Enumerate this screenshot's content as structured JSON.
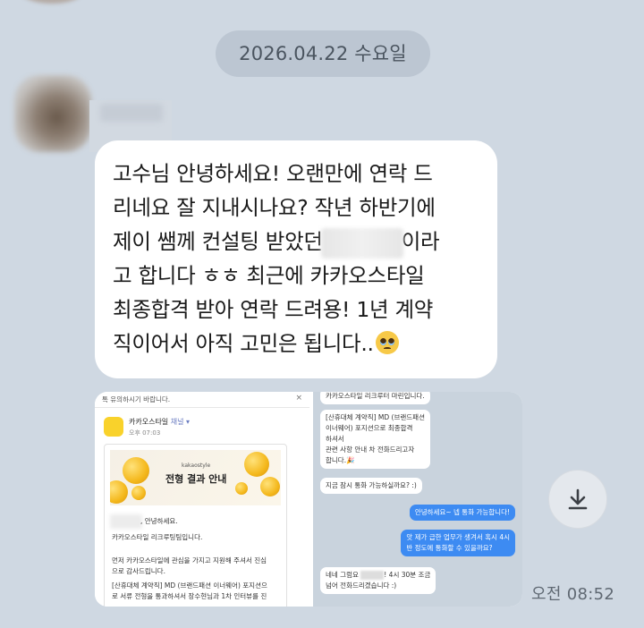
{
  "chat": {
    "date_divider": "2026.04.22 수요일",
    "message": {
      "lines": [
        "고수님 안녕하세요! 오랜만에 연락 드",
        "리네요 잘 지내시나요? 작년 하반기에",
        "제이 쌤께 컨설팅 받았던",
        "이라",
        "고 합니다 ㅎㅎ 최근에 카카오스타일",
        "최종합격 받아 연락 드려용! 1년 계약",
        "직이어서 아직 고민은 됩니다.."
      ],
      "emoji": "pleading-face-emoji"
    },
    "attachment": {
      "left": {
        "notice": "톡 유의하시기 바랍니다.",
        "close": "×",
        "channel_name": "카카오스타일",
        "channel_badge": "채널 ▾",
        "time": "오후 07:03",
        "banner_brand": "kakaostyle",
        "banner_title": "전형 결과 안내",
        "greeting": ", 안녕하세요.",
        "sender": "카카오스타일 리크루팅팀입니다.",
        "body1": "먼저 카카오스타일에 관심을 가지고 지원해 주셔서 진심",
        "body2": "으로 감사드립니다.",
        "body3": "[산휴대체 계약직] MD (브랜드패션 이너웨어) 포지션으",
        "body4": "로 서류 전형을 통과하셔서 장수현님과 1차 인터뷰를 진"
      },
      "right": {
        "in1": [
          "카카오스타일 리크루터 마린입니다."
        ],
        "in2": [
          "[산휴대체 계약직] MD (브랜드패션",
          "이너웨어) 포지션으로 최종합격",
          "하셔서",
          "관련 사항 안내 차 전화드리고자",
          "합니다.🎉"
        ],
        "in3": [
          "지금 잠시 통화 가능하실까요? :)"
        ],
        "out1": "안녕하세요~ 넵 통화 가능합니다!",
        "out2": [
          "앗 제가 급한 업무가 생겨서 혹시 4시",
          "반 정도에 통화할 수 있을까요?"
        ],
        "in4a": "네네 그럼요",
        "in4b": "! 4시 30분 조금",
        "in4c": "넘어 전화드리겠습니다 :)"
      }
    },
    "time": "오전 08:52",
    "download_icon": "download-icon"
  },
  "colors": {
    "background": "#cfd8e2",
    "bubble": "#ffffff",
    "date_pill": "#bcc6d2",
    "sent_bubble": "#3d8bf2"
  }
}
